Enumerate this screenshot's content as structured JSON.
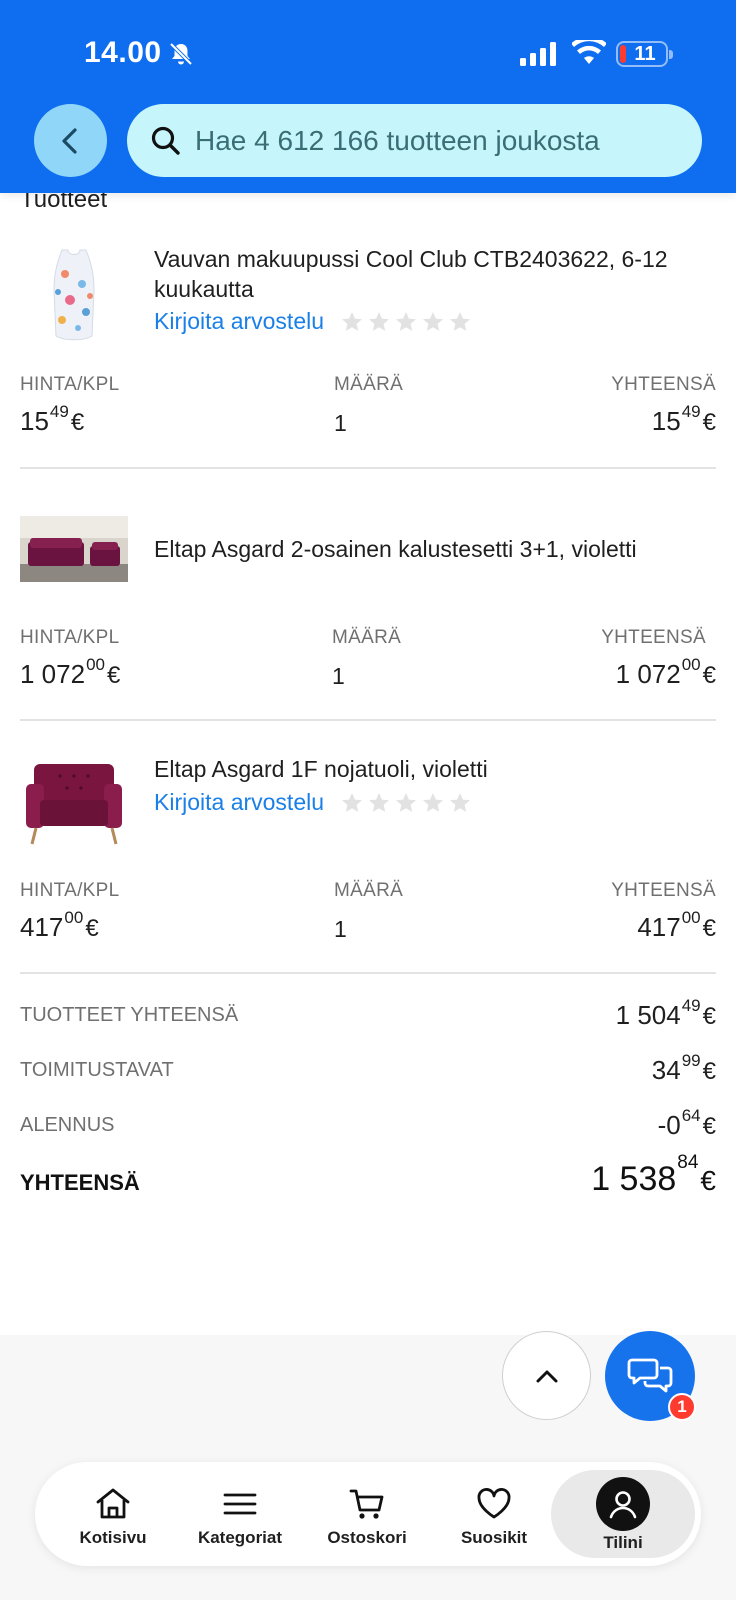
{
  "status_bar": {
    "time": "14.00",
    "battery": "11"
  },
  "header": {
    "search_placeholder": "Hae 4 612 166 tuotteen joukosta"
  },
  "section_title": "Tuotteet",
  "columns": {
    "price_label": "HINTA/KPL",
    "qty_label": "MÄÄRÄ",
    "total_label": "YHTEENSÄ"
  },
  "products": [
    {
      "name": "Vauvan makuupussi Cool Club CTB2403622, 6-12 kuukautta",
      "review_link": "Kirjoita arvostelu",
      "rating": 0,
      "price_int": "15",
      "price_dec": "49",
      "qty": "1",
      "total_int": "15",
      "total_dec": "49"
    },
    {
      "name": "Eltap Asgard 2-osainen kalustesetti 3+1, violetti",
      "price_int": "1 072",
      "price_dec": "00",
      "qty": "1",
      "total_int": "1 072",
      "total_dec": "00"
    },
    {
      "name": "Eltap Asgard 1F nojatuoli, violetti",
      "review_link": "Kirjoita arvostelu",
      "rating": 0,
      "price_int": "417",
      "price_dec": "00",
      "qty": "1",
      "total_int": "417",
      "total_dec": "00"
    }
  ],
  "currency": "€",
  "summary": {
    "products_total_label": "TUOTTEET YHTEENSÄ",
    "products_total_int": "1 504",
    "products_total_dec": "49",
    "shipping_label": "TOIMITUSTAVAT",
    "shipping_int": "34",
    "shipping_dec": "99",
    "discount_label": "ALENNUS",
    "discount_int": "-0",
    "discount_dec": "64",
    "grand_total_label": "YHTEENSÄ",
    "grand_total_int": "1 538",
    "grand_total_dec": "84"
  },
  "chat_badge": "1",
  "tabs": [
    {
      "label": "Kotisivu",
      "icon": "home-icon"
    },
    {
      "label": "Kategoriat",
      "icon": "menu-icon"
    },
    {
      "label": "Ostoskori",
      "icon": "cart-icon"
    },
    {
      "label": "Suosikit",
      "icon": "heart-icon"
    },
    {
      "label": "Tilini",
      "icon": "account-icon",
      "active": true
    }
  ],
  "colors": {
    "header_blue": "#0f6ef0",
    "search_bg": "#c6f6fb",
    "back_button_bg": "#8fd6f8",
    "link_blue": "#1a7fe6",
    "chat_blue": "#1673ec",
    "badge_red": "#ff3b30"
  }
}
